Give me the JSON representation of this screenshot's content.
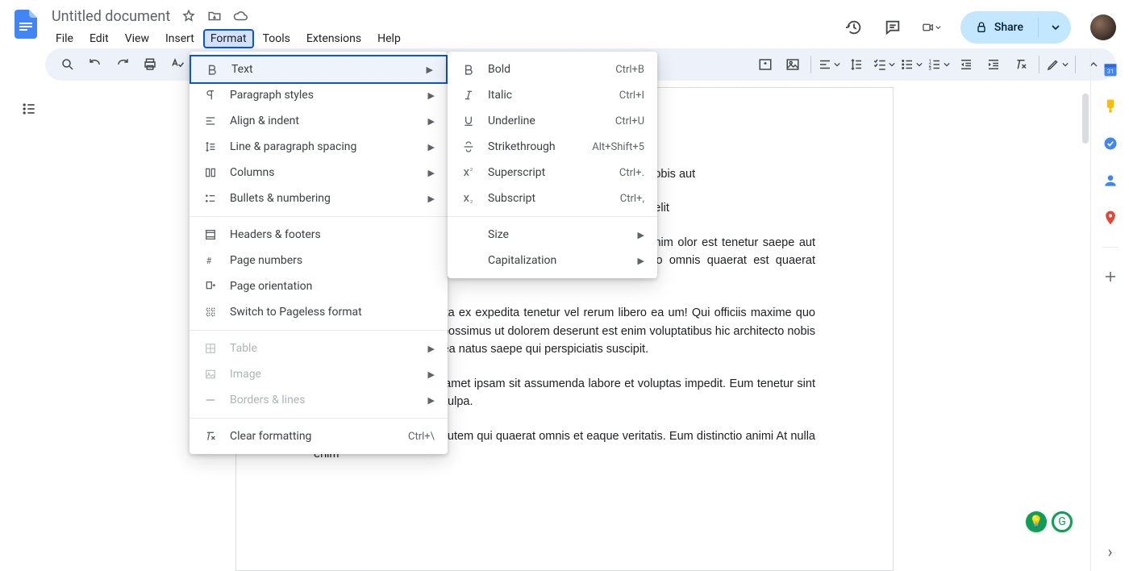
{
  "doc": {
    "title": "Untitled document"
  },
  "menubar": [
    "File",
    "Edit",
    "View",
    "Insert",
    "Format",
    "Tools",
    "Extensions",
    "Help"
  ],
  "menubar_active_index": 4,
  "share": {
    "label": "Share"
  },
  "format_menu": {
    "groups": [
      [
        {
          "icon": "bold-icon",
          "label": "Text",
          "arrow": true,
          "highlighted": true
        },
        {
          "icon": "paragraph-icon",
          "label": "Paragraph styles",
          "arrow": true
        },
        {
          "icon": "align-icon",
          "label": "Align & indent",
          "arrow": true
        },
        {
          "icon": "spacing-icon",
          "label": "Line & paragraph spacing",
          "arrow": true
        },
        {
          "icon": "columns-icon",
          "label": "Columns",
          "arrow": true
        },
        {
          "icon": "bullets-icon",
          "label": "Bullets & numbering",
          "arrow": true
        }
      ],
      [
        {
          "icon": "headers-icon",
          "label": "Headers & footers"
        },
        {
          "icon": "pagenum-icon",
          "label": "Page numbers"
        },
        {
          "icon": "orientation-icon",
          "label": "Page orientation"
        },
        {
          "icon": "pageless-icon",
          "label": "Switch to Pageless format"
        }
      ],
      [
        {
          "icon": "table-icon",
          "label": "Table",
          "arrow": true,
          "disabled": true
        },
        {
          "icon": "image-icon",
          "label": "Image",
          "arrow": true,
          "disabled": true
        },
        {
          "icon": "borders-icon",
          "label": "Borders & lines",
          "arrow": true,
          "disabled": true
        }
      ],
      [
        {
          "icon": "clear-icon",
          "label": "Clear formatting",
          "shortcut": "Ctrl+\\"
        }
      ]
    ]
  },
  "text_submenu": {
    "groups": [
      [
        {
          "icon": "bold-icon",
          "label": "Bold",
          "shortcut": "Ctrl+B"
        },
        {
          "icon": "italic-icon",
          "label": "Italic",
          "shortcut": "Ctrl+I"
        },
        {
          "icon": "underline-icon",
          "label": "Underline",
          "shortcut": "Ctrl+U"
        },
        {
          "icon": "strike-icon",
          "label": "Strikethrough",
          "shortcut": "Alt+Shift+5"
        },
        {
          "icon": "superscript-icon",
          "label": "Superscript",
          "shortcut": "Ctrl+."
        },
        {
          "icon": "subscript-icon",
          "label": "Subscript",
          "shortcut": "Ctrl+,"
        }
      ],
      [
        {
          "label": "Size",
          "arrow": true
        },
        {
          "label": "Capitalization",
          "arrow": true
        }
      ]
    ]
  },
  "body_paragraphs": [
    "netur vel rerum libero ea qui sapiente possimus ut hic architecto nobis aut",
    "m sit assumenda labore et voluptas impedit. Eum tenetur sint sit velit",
    "quaerat omnis et eaque veritatis. Eum distinctio animi At nulla enim olor est tenetur saepe aut fugit doloribus. Est pariatur voluptatem qui fficia cupiditate quo omnis quaerat est quaerat suscipit.",
    "rror earum sed quam dicta ex expedita tenetur vel rerum libero ea um! Qui officiis maxime quo vero neque qui sapiente possimus ut dolorem deserunt est enim voluptatibus hic architecto nobis aut necessitatibus libero ea natus saepe qui perspiciatis suscipit.",
    "Et consequatur dolor vel amet ipsam sit assumenda labore et voluptas impedit. Eum tenetur sint sit velit itaque non culpa culpa.",
    "In quod dolore ut autem autem qui quaerat omnis et eaque veritatis. Eum distinctio animi At nulla enim"
  ]
}
